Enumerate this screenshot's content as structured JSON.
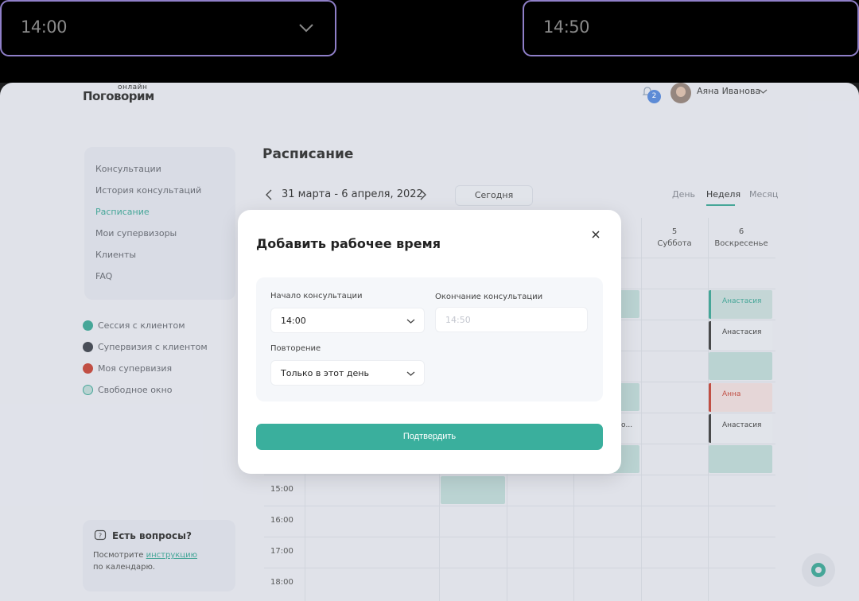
{
  "zoom": {
    "start_value": "14:00",
    "end_value": "14:50"
  },
  "header": {
    "logo_main": "Поговорим",
    "logo_small": "онлайн",
    "notification_count": "2",
    "user_name": "Аяна Иванова"
  },
  "sidebar": {
    "items": [
      {
        "label": "Консультации"
      },
      {
        "label": "История консультаций"
      },
      {
        "label": "Расписание"
      },
      {
        "label": "Мои супервизоры"
      },
      {
        "label": "Клиенты"
      },
      {
        "label": "FAQ"
      }
    ],
    "active_index": 2
  },
  "legend": [
    {
      "label": "Сессия с клиентом",
      "color": "#2f9f8e"
    },
    {
      "label": "Супервизия с клиентом",
      "color": "#333842"
    },
    {
      "label": "Моя супервизия",
      "color": "#c0392b"
    },
    {
      "label": "Свободное окно",
      "color": "#b8d4d2"
    }
  ],
  "help": {
    "title": "Есть вопросы?",
    "text_before": "Посмотрите ",
    "link": "инструкцию",
    "text_after": "по календарю."
  },
  "schedule": {
    "title": "Расписание",
    "date_range": "31 марта - 6 апреля, 2022",
    "today_label": "Сегодня",
    "views": [
      "День",
      "Неделя",
      "Месяц"
    ],
    "active_view": "Неделя",
    "columns": [
      {
        "day": "5",
        "weekday": "Суббота"
      },
      {
        "day": "6",
        "weekday": "Воскресенье"
      }
    ],
    "times": [
      "15:00",
      "16:00",
      "17:00",
      "18:00"
    ],
    "events": [
      {
        "label": "Анастасия",
        "kind": "green"
      },
      {
        "label": "Анастасия",
        "kind": "dark"
      },
      {
        "label": "Анна",
        "kind": "red"
      },
      {
        "label": "Анастасия",
        "kind": "dark"
      },
      {
        "label": "о...",
        "kind": "plain"
      }
    ]
  },
  "modal": {
    "title": "Добавить рабочее время",
    "start_label": "Начало консультации",
    "start_value": "14:00",
    "end_label": "Окончание консультации",
    "end_placeholder": "14:50",
    "repeat_label": "Повторение",
    "repeat_value": "Только в этот день",
    "confirm_label": "Подтвердить"
  }
}
